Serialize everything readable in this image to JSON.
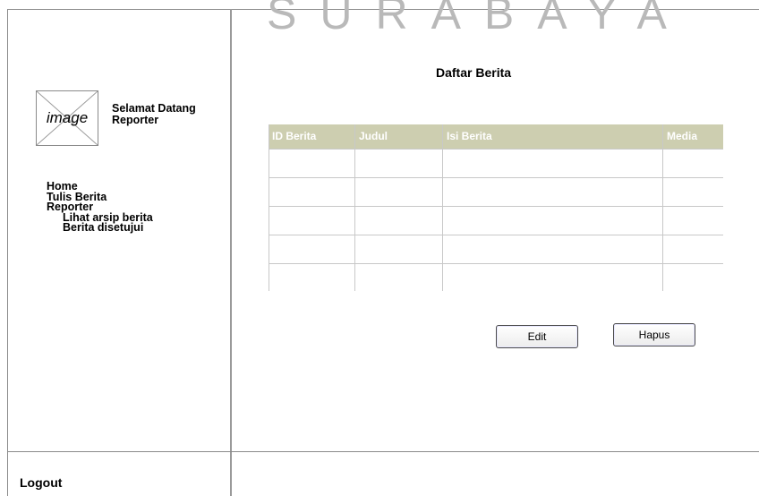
{
  "watermark": "SURABAYA",
  "sidebar": {
    "logo_text": "image",
    "welcome_line1": "Selamat Datang",
    "welcome_line2": "Reporter",
    "nav": {
      "home": "Home",
      "tulis_berita": "Tulis Berita",
      "reporter": "Reporter",
      "lihat_arsip": "Lihat arsip berita",
      "berita_disetujui": "Berita disetujui"
    },
    "logout": "Logout"
  },
  "main": {
    "title": "Daftar Berita",
    "table": {
      "columns": [
        "ID Berita",
        "Judul",
        "Isi Berita",
        "Media"
      ],
      "rows": [
        [
          "",
          "",
          "",
          ""
        ],
        [
          "",
          "",
          "",
          ""
        ],
        [
          "",
          "",
          "",
          ""
        ],
        [
          "",
          "",
          "",
          ""
        ],
        [
          "",
          "",
          "",
          ""
        ]
      ]
    },
    "buttons": {
      "edit": "Edit",
      "hapus": "Hapus"
    }
  },
  "colors": {
    "table_header_bg": "#cdceb0",
    "frame_line": "#8a8a8a"
  }
}
